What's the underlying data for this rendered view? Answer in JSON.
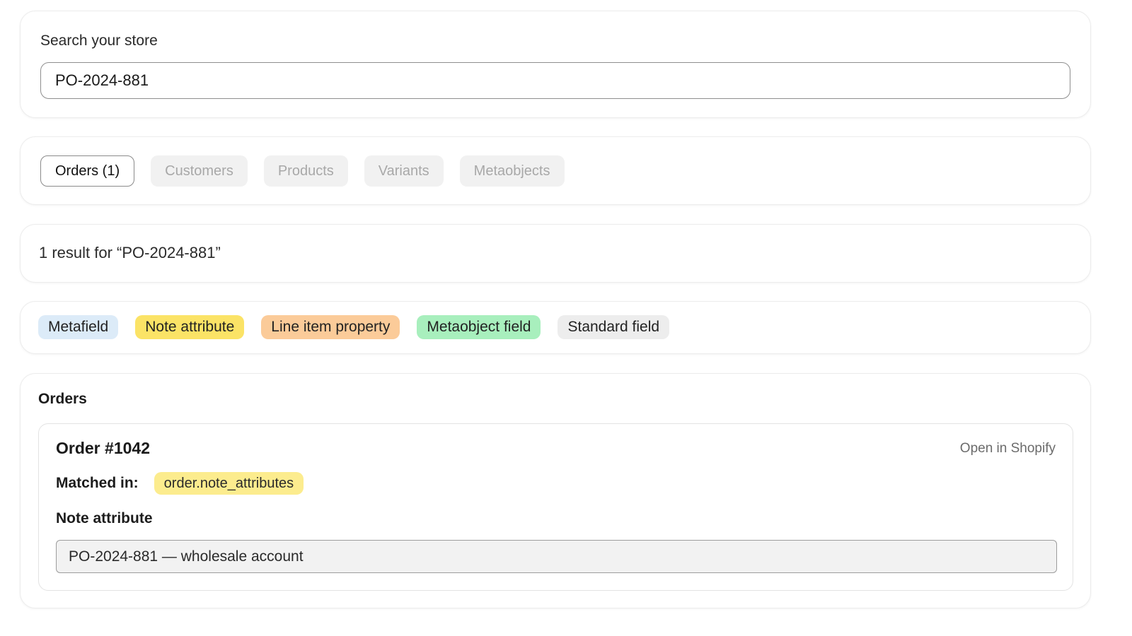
{
  "search": {
    "label": "Search your store",
    "value": "PO-2024-881"
  },
  "tabs": [
    {
      "label": "Orders (1)",
      "active": true
    },
    {
      "label": "Customers",
      "active": false
    },
    {
      "label": "Products",
      "active": false
    },
    {
      "label": "Variants",
      "active": false
    },
    {
      "label": "Metaobjects",
      "active": false
    }
  ],
  "results": {
    "summary": "1 result for “PO-2024-881”"
  },
  "legend": [
    {
      "label": "Metafield",
      "color": "#dcebf8"
    },
    {
      "label": "Note attribute",
      "color": "#fbe366"
    },
    {
      "label": "Line item property",
      "color": "#fbcb99"
    },
    {
      "label": "Metaobject field",
      "color": "#a8efbd"
    },
    {
      "label": "Standard field",
      "color": "#ededed"
    }
  ],
  "orders": {
    "heading": "Orders",
    "items": [
      {
        "title": "Order #1042",
        "open_link": "Open in Shopify",
        "matched_label": "Matched in:",
        "matched_value": "order.note_attributes",
        "matched_color": "#fcec8e",
        "field_label": "Note attribute",
        "field_value": "PO-2024-881 — wholesale account"
      }
    ]
  }
}
